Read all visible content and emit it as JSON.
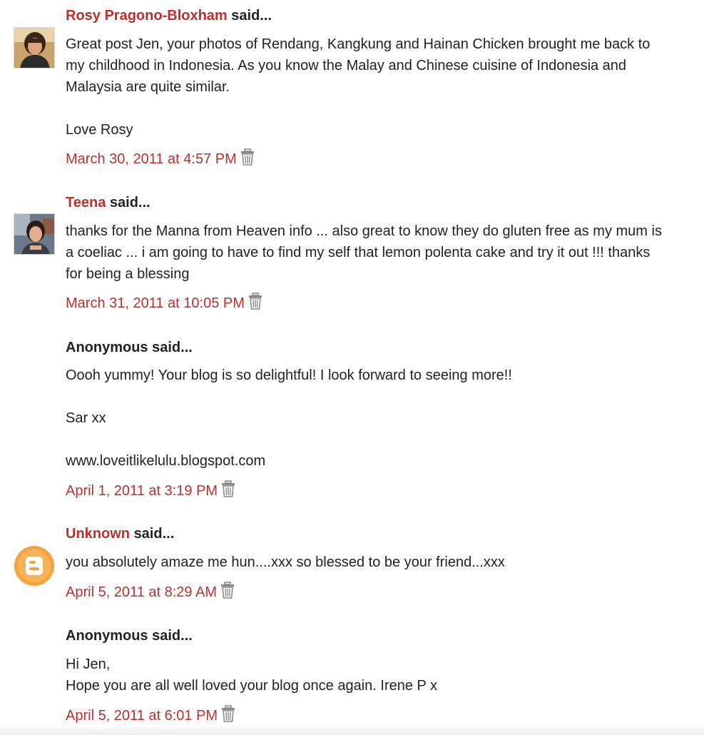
{
  "comments": [
    {
      "author": "Rosy Pragono-Bloxham",
      "author_is_link": true,
      "said": "said...",
      "avatar": "photo-avatar",
      "body": [
        "Great post Jen, your photos of Rendang, Kangkung and Hainan Chicken brought me back to my childhood in Indonesia. As you know the Malay and Chinese cuisine of Indonesia and Malaysia are quite similar.",
        "Love Rosy"
      ],
      "timestamp": "March 30, 2011 at 4:57 PM"
    },
    {
      "author": "Teena",
      "author_is_link": true,
      "said": "said...",
      "avatar": "photo-avatar",
      "body": [
        "thanks for the Manna from Heaven info ... also great to know they do gluten free as my mum is a coeliac ... i am going to have to find my self that lemon polenta cake and try it out !!! thanks for being a blessing"
      ],
      "timestamp": "March 31, 2011 at 10:05 PM"
    },
    {
      "author": "Anonymous",
      "author_is_link": false,
      "said": "said...",
      "avatar": "none",
      "body": [
        "Oooh yummy! Your blog is so delightful! I look forward to seeing more!!",
        "Sar xx",
        "www.loveitlikelulu.blogspot.com"
      ],
      "timestamp": "April 1, 2011 at 3:19 PM"
    },
    {
      "author": "Unknown",
      "author_is_link": true,
      "said": "said...",
      "avatar": "blogger-icon",
      "body": [
        "you absolutely amaze me hun....xxx so blessed to be your friend...xxx"
      ],
      "timestamp": "April 5, 2011 at 8:29 AM"
    },
    {
      "author": "Anonymous",
      "author_is_link": false,
      "said": "said...",
      "avatar": "none",
      "body": [
        "Hi Jen,",
        "Hope you are all well loved your blog once again. Irene P x"
      ],
      "timestamp": "April 5, 2011 at 6:01 PM"
    }
  ],
  "colors": {
    "link": "#b8312f",
    "text": "#222222",
    "blogger_orange": "#f5a33d",
    "trash_icon": "#8a8a8a"
  },
  "icons": {
    "delete": "trash-icon",
    "blogger": "blogger-icon"
  }
}
